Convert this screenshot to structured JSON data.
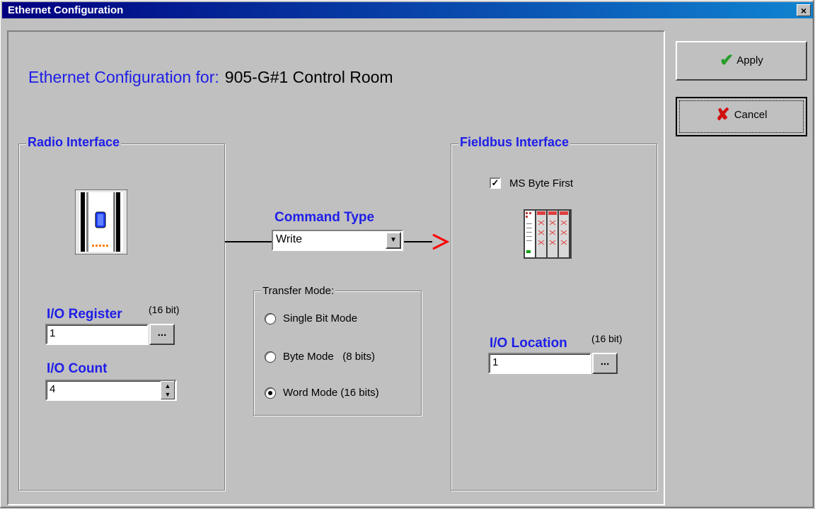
{
  "window": {
    "title": "Ethernet Configuration",
    "close_label": "×"
  },
  "heading": {
    "label": "Ethernet Configuration for:",
    "value": "905-G#1 Control Room"
  },
  "radio_interface": {
    "title": "Radio Interface",
    "io_register_label": "I/O Register",
    "io_register_unit": "(16 bit)",
    "io_register_value": "1",
    "browse_label": "...",
    "io_count_label": "I/O Count",
    "io_count_value": "4"
  },
  "command": {
    "title": "Command Type",
    "selected": "Write"
  },
  "transfer_mode": {
    "title": "Transfer Mode:",
    "options": [
      "Single Bit Mode",
      "Byte Mode   (8 bits)",
      "Word Mode (16 bits)"
    ],
    "selected_index": 2
  },
  "fieldbus_interface": {
    "title": "Fieldbus Interface",
    "ms_byte_first_label": "MS Byte First",
    "ms_byte_first_checked": true,
    "io_location_label": "I/O Location",
    "io_location_unit": "(16 bit)",
    "io_location_value": "1",
    "browse_label": "..."
  },
  "buttons": {
    "apply": "Apply",
    "cancel": "Cancel"
  },
  "colors": {
    "accent": "#1e1ee8",
    "title_start": "#000080",
    "arrow": "#ff0000"
  }
}
